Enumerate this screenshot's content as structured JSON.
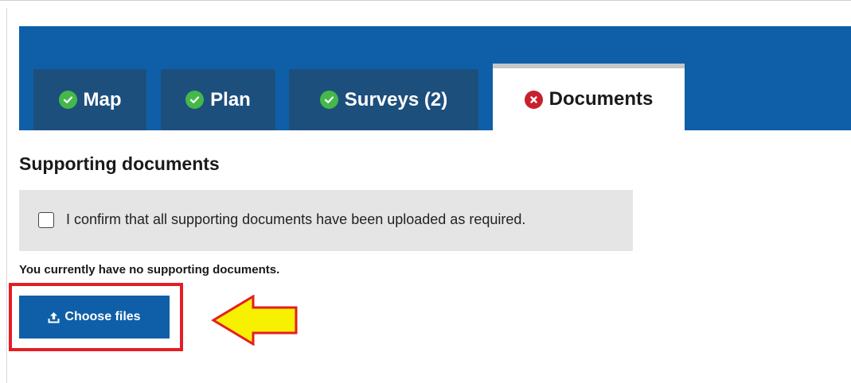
{
  "tabs": [
    {
      "label": "Map",
      "status_icon": "check-circle-icon"
    },
    {
      "label": "Plan",
      "status_icon": "check-circle-icon"
    },
    {
      "label": "Surveys (2)",
      "status_icon": "check-circle-icon"
    },
    {
      "label": "Documents",
      "status_icon": "x-circle-icon",
      "active": true
    }
  ],
  "section": {
    "title": "Supporting documents",
    "confirm_label": "I confirm that all supporting documents have been uploaded as required.",
    "confirm_checked": false,
    "empty_message": "You currently have no supporting documents.",
    "choose_button_label": "Choose files",
    "choose_button_icon": "upload-icon"
  },
  "annotation": {
    "highlight_color": "#e51d23",
    "arrow_color": "#f7f000",
    "arrow_icon": "left-arrow-icon"
  },
  "colors": {
    "header_band": "#0f5fa8",
    "tab_inactive": "#1d4f7d",
    "check_green": "#44b84a",
    "error_red": "#c8202f"
  }
}
